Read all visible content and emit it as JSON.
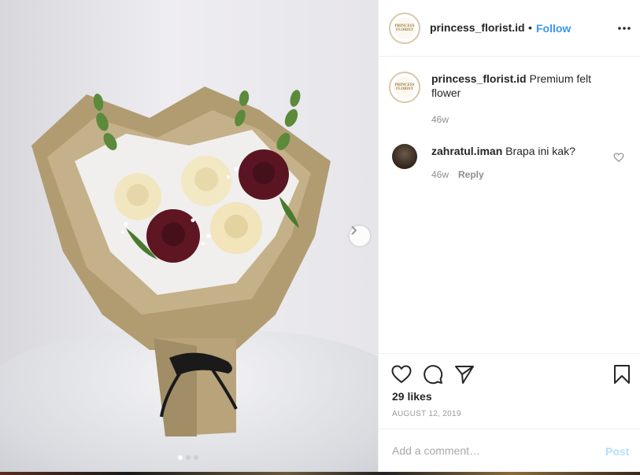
{
  "post": {
    "username": "princess_florist.id",
    "follow_label": "Follow",
    "separator": "•",
    "avatar_logo_text": "PRINCESS FLORIST"
  },
  "caption": {
    "username": "princess_florist.id",
    "text": "Premium felt flower",
    "age": "46w"
  },
  "comments": [
    {
      "username": "zahratul.iman",
      "text": "Brapa ini kak?",
      "age": "46w",
      "reply_label": "Reply"
    }
  ],
  "likes": "29 likes",
  "date": "AUGUST 12, 2019",
  "add_comment": {
    "placeholder": "Add a comment…",
    "post_label": "Post"
  },
  "carousel": {
    "total": 3,
    "active": 1
  },
  "colors": {
    "follow": "#3897f0",
    "post_disabled": "#b2dffc",
    "muted": "#8e8e8e"
  },
  "icons": [
    "chevron-right-icon",
    "more-icon",
    "heart-icon",
    "comment-icon",
    "share-icon",
    "bookmark-icon"
  ]
}
